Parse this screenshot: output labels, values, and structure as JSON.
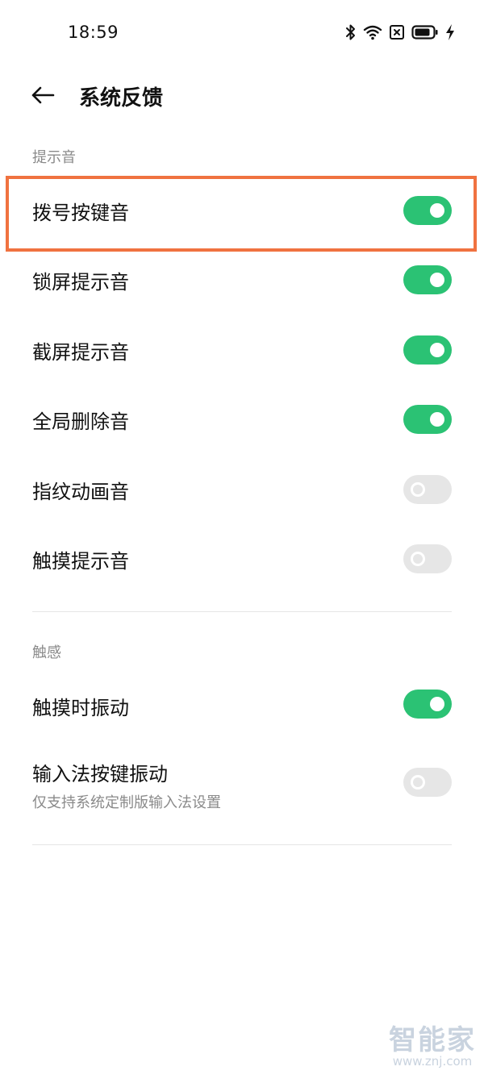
{
  "status_bar": {
    "time": "18:59",
    "icons": [
      "bluetooth-icon",
      "wifi-icon",
      "sim-off-icon",
      "battery-icon",
      "charging-icon"
    ]
  },
  "header": {
    "back_icon": "arrow-left-icon",
    "title": "系统反馈"
  },
  "sections": {
    "sound": {
      "title": "提示音",
      "items": [
        {
          "label": "拨号按键音",
          "enabled": true
        },
        {
          "label": "锁屏提示音",
          "enabled": true
        },
        {
          "label": "截屏提示音",
          "enabled": true
        },
        {
          "label": "全局删除音",
          "enabled": true
        },
        {
          "label": "指纹动画音",
          "enabled": false
        },
        {
          "label": "触摸提示音",
          "enabled": false
        }
      ]
    },
    "haptics": {
      "title": "触感",
      "items": [
        {
          "label": "触摸时振动",
          "enabled": true
        },
        {
          "label": "输入法按键振动",
          "sub": "仅支持系统定制版输入法设置",
          "enabled": false
        }
      ]
    }
  },
  "colors": {
    "toggle_on": "#2bc274",
    "toggle_off": "#e6e6e6",
    "highlight": "#f07240"
  },
  "watermark": {
    "logo": "智能家",
    "url": "www.znj.com"
  }
}
